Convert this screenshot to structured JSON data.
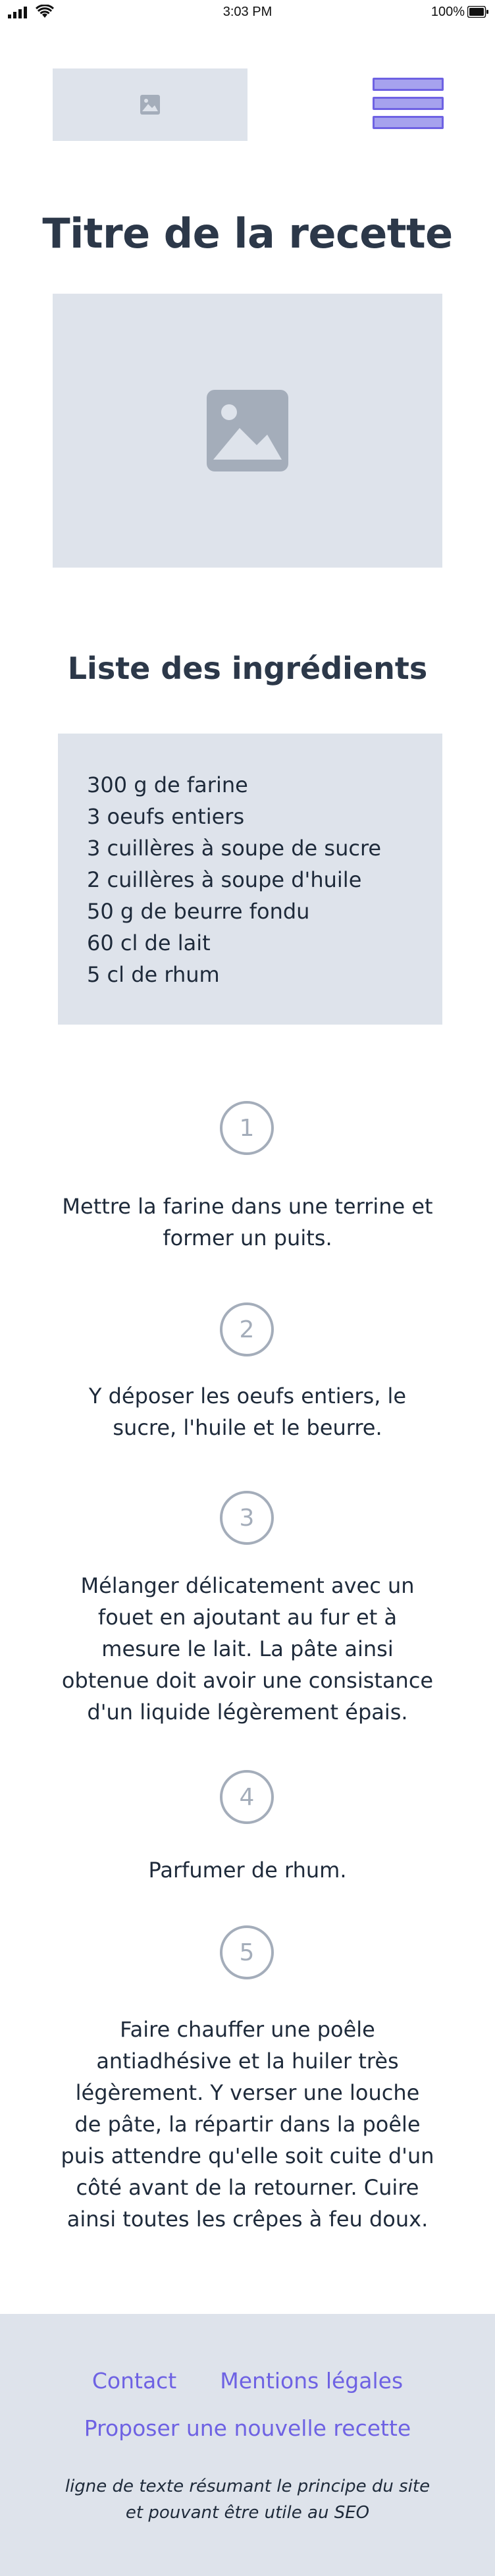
{
  "status_bar": {
    "time": "3:03 PM",
    "battery": "100%"
  },
  "header": {
    "logo_icon": "image-placeholder-icon",
    "menu_icon": "hamburger-menu-icon"
  },
  "recipe": {
    "title": "Titre de la recette",
    "image_icon": "image-placeholder-icon",
    "ingredients_title": "Liste des ingrédients",
    "ingredients": [
      "300 g de farine",
      "3 oeufs entiers",
      "3 cuillères à soupe de sucre",
      "2 cuillères à soupe d'huile",
      "50 g de beurre fondu",
      "60 cl de lait",
      "5 cl de rhum"
    ],
    "steps": [
      {
        "number": "1",
        "text": "Mettre la farine dans une terrine et former un puits."
      },
      {
        "number": "2",
        "text": "Y déposer les oeufs entiers, le sucre, l'huile et le beurre."
      },
      {
        "number": "3",
        "text": "Mélanger délicatement avec un fouet en ajoutant au fur et à mesure le lait. La pâte ainsi obtenue doit avoir une consistance d'un liquide légèrement épais."
      },
      {
        "number": "4",
        "text": "Parfumer de rhum."
      },
      {
        "number": "5",
        "text": "Faire chauffer une poêle antiadhésive et la huiler très légèrement. Y verser une louche de pâte, la répartir dans la poêle puis attendre qu'elle soit cuite d'un côté avant de la retourner. Cuire ainsi toutes les crêpes à feu doux."
      }
    ]
  },
  "footer": {
    "contact": "Contact",
    "legal": "Mentions légales",
    "propose": "Proposer une nouvelle recette",
    "seo_text": "ligne de texte résumant le principe du site et pouvant être utile au SEO"
  },
  "colors": {
    "accent": "#6e62e3",
    "placeholder_bg": "#dee3eb",
    "text": "#1e2a3a",
    "muted": "#a4adba"
  }
}
